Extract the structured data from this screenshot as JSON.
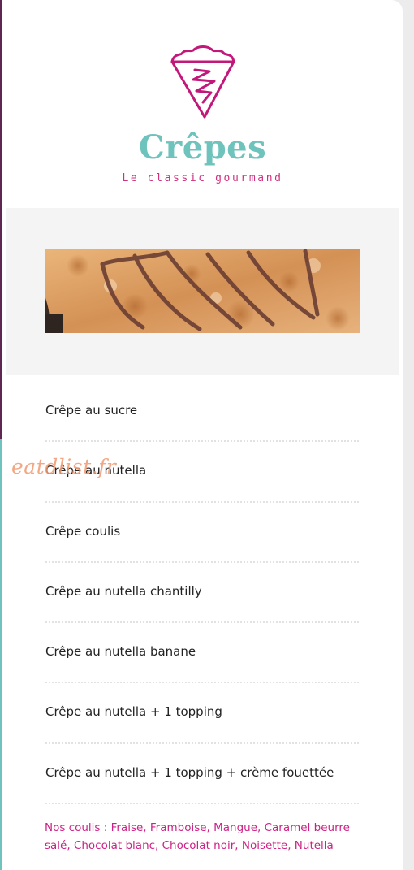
{
  "brand": {
    "title": "Crêpes",
    "tagline": "Le classic gourmand",
    "title_color": "#6fc3bd",
    "tagline_color": "#d0307f",
    "logo_icon": "crepe-slice-icon"
  },
  "menu": {
    "items": [
      {
        "label": "Crêpe au sucre"
      },
      {
        "label": "Crêpe au nutella"
      },
      {
        "label": "Crêpe coulis"
      },
      {
        "label": "Crêpe au nutella chantilly"
      },
      {
        "label": "Crêpe au nutella banane"
      },
      {
        "label": "Crêpe au nutella + 1 topping"
      },
      {
        "label": "Crêpe au nutella + 1 topping + crème fouettée"
      }
    ]
  },
  "note": "Nos coulis : Fraise, Framboise, Mangue, Caramel beurre salé, Chocolat blanc, Chocolat noir, Noisette, Nutella",
  "watermark": "eatdlist.fr",
  "colors": {
    "accent_pink": "#cc2287",
    "accent_teal": "#6fc3bd",
    "edge_purple": "#5e2750"
  }
}
